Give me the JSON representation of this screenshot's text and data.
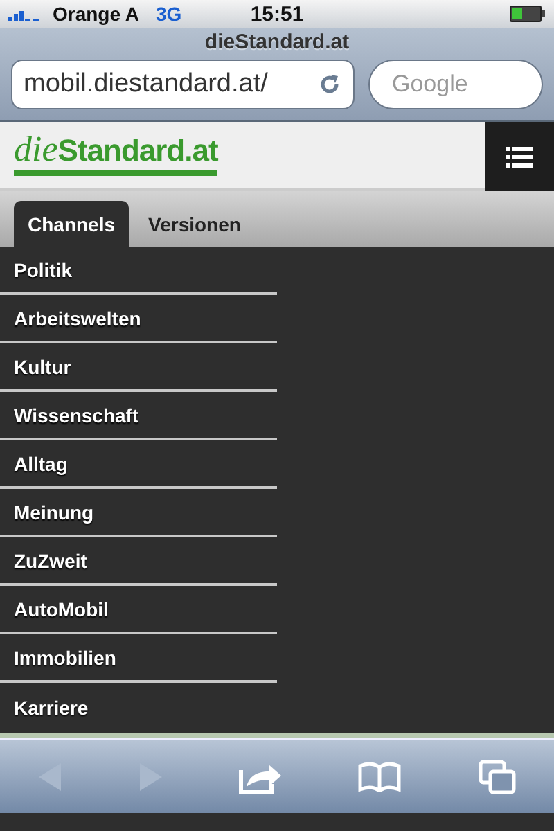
{
  "status_bar": {
    "carrier": "Orange A",
    "network": "3G",
    "time": "15:51"
  },
  "browser": {
    "title": "dieStandard.at",
    "url": "mobil.diestandard.at/",
    "search_placeholder": "Google"
  },
  "site_header": {
    "logo_prefix": "die",
    "logo_name": "Standard.at"
  },
  "tabs": [
    {
      "label": "Channels",
      "selected": true
    },
    {
      "label": "Versionen",
      "selected": false
    }
  ],
  "channels": [
    "Politik",
    "Arbeitswelten",
    "Kultur",
    "Wissenschaft",
    "Alltag",
    "Meinung",
    "ZuZweit",
    "AutoMobil",
    "Immobilien",
    "Karriere"
  ],
  "toolbar": {
    "back_disabled": true,
    "forward_disabled": true
  }
}
